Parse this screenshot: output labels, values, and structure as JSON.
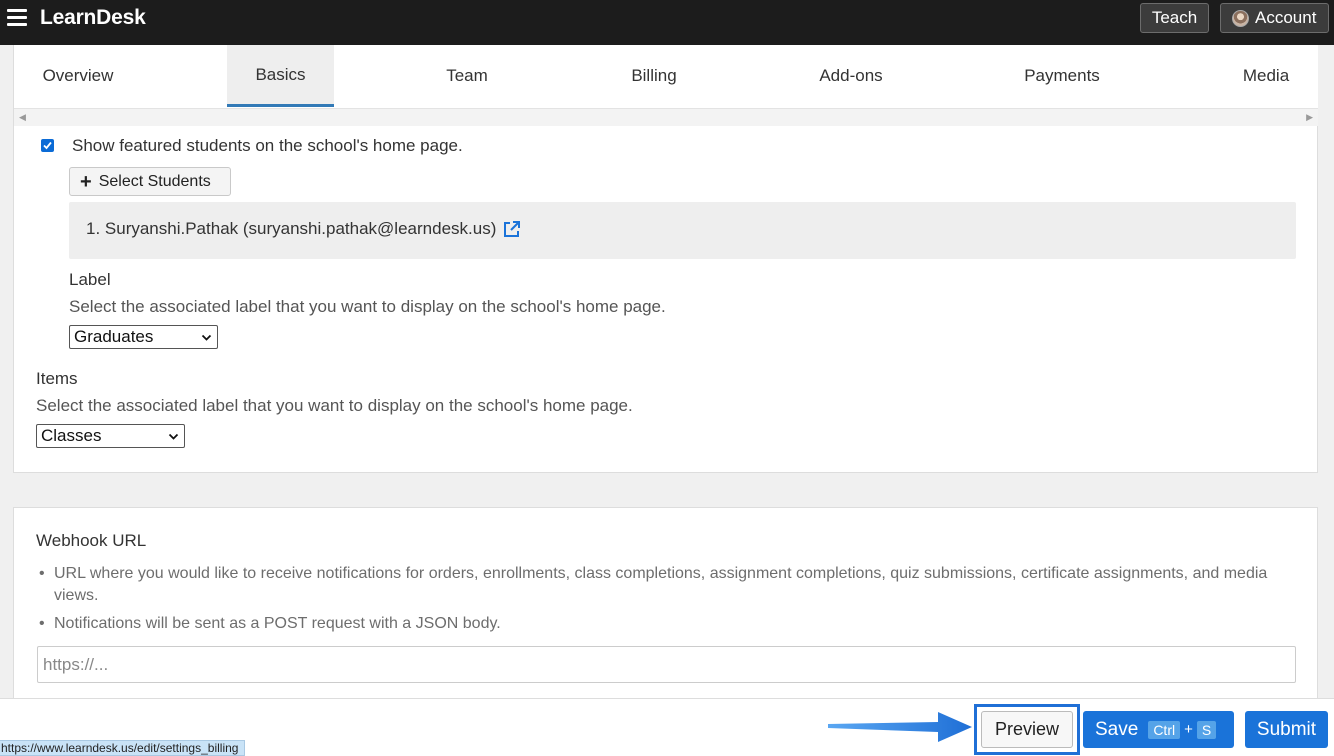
{
  "header": {
    "brand": "LearnDesk",
    "teach_label": "Teach",
    "account_label": "Account"
  },
  "tabs": [
    {
      "label": "Overview",
      "active": false
    },
    {
      "label": "Basics",
      "active": true
    },
    {
      "label": "Team",
      "active": false
    },
    {
      "label": "Billing",
      "active": false
    },
    {
      "label": "Add-ons",
      "active": false
    },
    {
      "label": "Payments",
      "active": false
    },
    {
      "label": "Media",
      "active": false
    }
  ],
  "featured": {
    "checkbox_label": "Show featured students on the school's home page.",
    "checked": true,
    "select_students_label": "Select Students",
    "students": [
      "1. Suryanshi.Pathak (suryanshi.pathak@learndesk.us)"
    ],
    "label_heading": "Label",
    "label_desc": "Select the associated label that you want to display on the school's home page.",
    "label_value": "Graduates",
    "items_heading": "Items",
    "items_desc": "Select the associated label that you want to display on the school's home page.",
    "items_value": "Classes"
  },
  "webhook": {
    "heading": "Webhook URL",
    "bullets": [
      "URL where you would like to receive notifications for orders, enrollments, class completions, assignment completions, quiz submissions, certificate assignments, and media views.",
      "Notifications will be sent as a POST request with a JSON body."
    ],
    "placeholder": "https://..."
  },
  "actions": {
    "preview_label": "Preview",
    "save_label": "Save",
    "shortcut_key1": "Ctrl",
    "shortcut_plus": "+",
    "shortcut_key2": "S",
    "submit_label": "Submit"
  },
  "status_url": "https://www.learndesk.us/edit/settings_billing",
  "colors": {
    "primary": "#1a73d9",
    "topbar": "#1c1c1c",
    "highlight": "#1f6fd6"
  }
}
